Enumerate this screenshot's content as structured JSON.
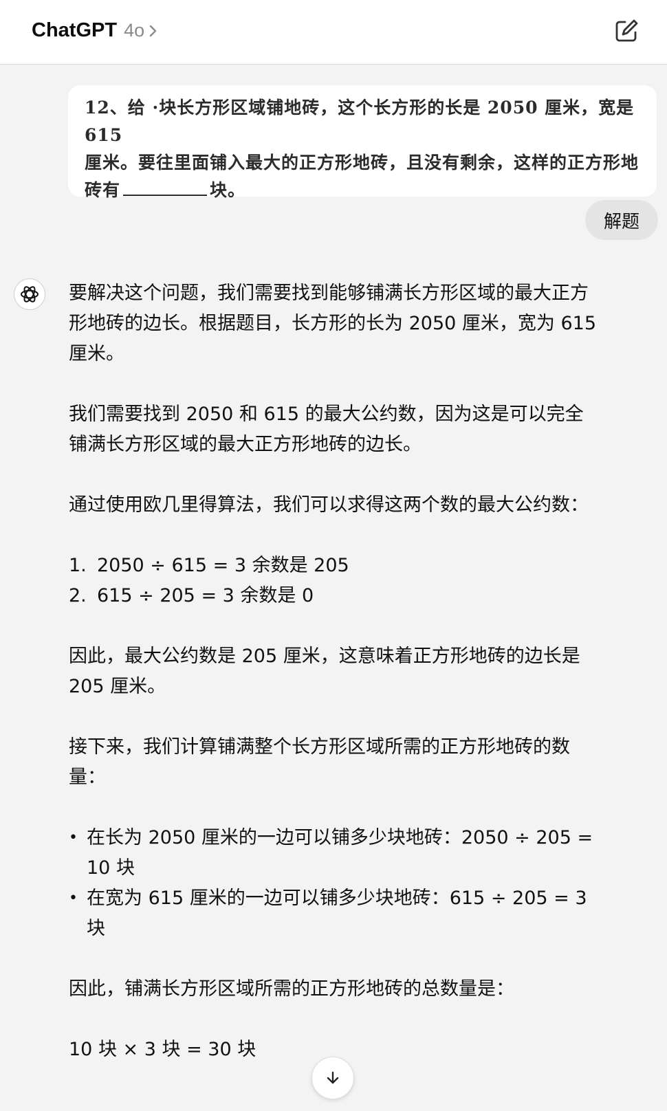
{
  "header": {
    "app_name": "ChatGPT",
    "model": "4o"
  },
  "icons": {
    "chevron": "chevron-right-icon",
    "compose": "new-chat-icon",
    "avatar": "openai-logo-icon",
    "scroll": "arrow-down-icon"
  },
  "question_image": {
    "line1": "12、给  ·块长方形区域铺地砖，这个长方形的长是 2050 厘米，宽是 615",
    "line2": "厘米。要往里面铺入最大的正方形地砖，且没有剩余，这样的正方形地",
    "line3_before": "砖有",
    "line3_after": "块。"
  },
  "user_message": "解题",
  "answer": {
    "p1": "要解决这个问题，我们需要找到能够铺满长方形区域的最大正方形地砖的边长。根据题目，长方形的长为 2050 厘米，宽为 615 厘米。",
    "p2": "我们需要找到 2050 和 615 的最大公约数，因为这是可以完全铺满长方形区域的最大正方形地砖的边长。",
    "p3": "通过使用欧几里得算法，我们可以求得这两个数的最大公约数：",
    "steps": [
      {
        "num": "1.",
        "text": "2050 ÷ 615 = 3 余数是 205"
      },
      {
        "num": "2.",
        "text": "615 ÷ 205 = 3 余数是 0"
      }
    ],
    "p4": "因此，最大公约数是 205 厘米，这意味着正方形地砖的边长是 205 厘米。",
    "p5": "接下来，我们计算铺满整个长方形区域所需的正方形地砖的数量：",
    "bullets": [
      {
        "dot": "•",
        "text": "在长为 2050 厘米的一边可以铺多少块地砖：2050 ÷ 205 = 10 块"
      },
      {
        "dot": "•",
        "text": "在宽为 615 厘米的一边可以铺多少块地砖：615 ÷ 205 = 3 块"
      }
    ],
    "p6": "因此，铺满长方形区域所需的正方形地砖的总数量是：",
    "p7": "10 块 × 3 块 = 30 块"
  }
}
